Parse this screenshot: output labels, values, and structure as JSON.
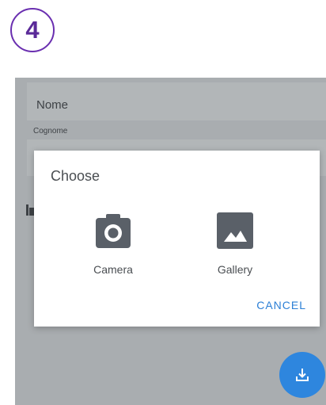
{
  "step": {
    "number": "4",
    "accent_color": "#6a2fb0"
  },
  "form": {
    "nome_label": "Nome",
    "cognome_label": "Cognome"
  },
  "dialog": {
    "title": "Choose",
    "options": [
      {
        "label": "Camera",
        "icon": "camera-icon"
      },
      {
        "label": "Gallery",
        "icon": "image-icon"
      }
    ],
    "cancel_label": "CANCEL"
  },
  "fab": {
    "icon": "download-icon",
    "color": "#2e86de"
  },
  "colors": {
    "overlay": "#a9adb0",
    "icon": "#5a6068",
    "accent_blue": "#2b7fd6"
  }
}
